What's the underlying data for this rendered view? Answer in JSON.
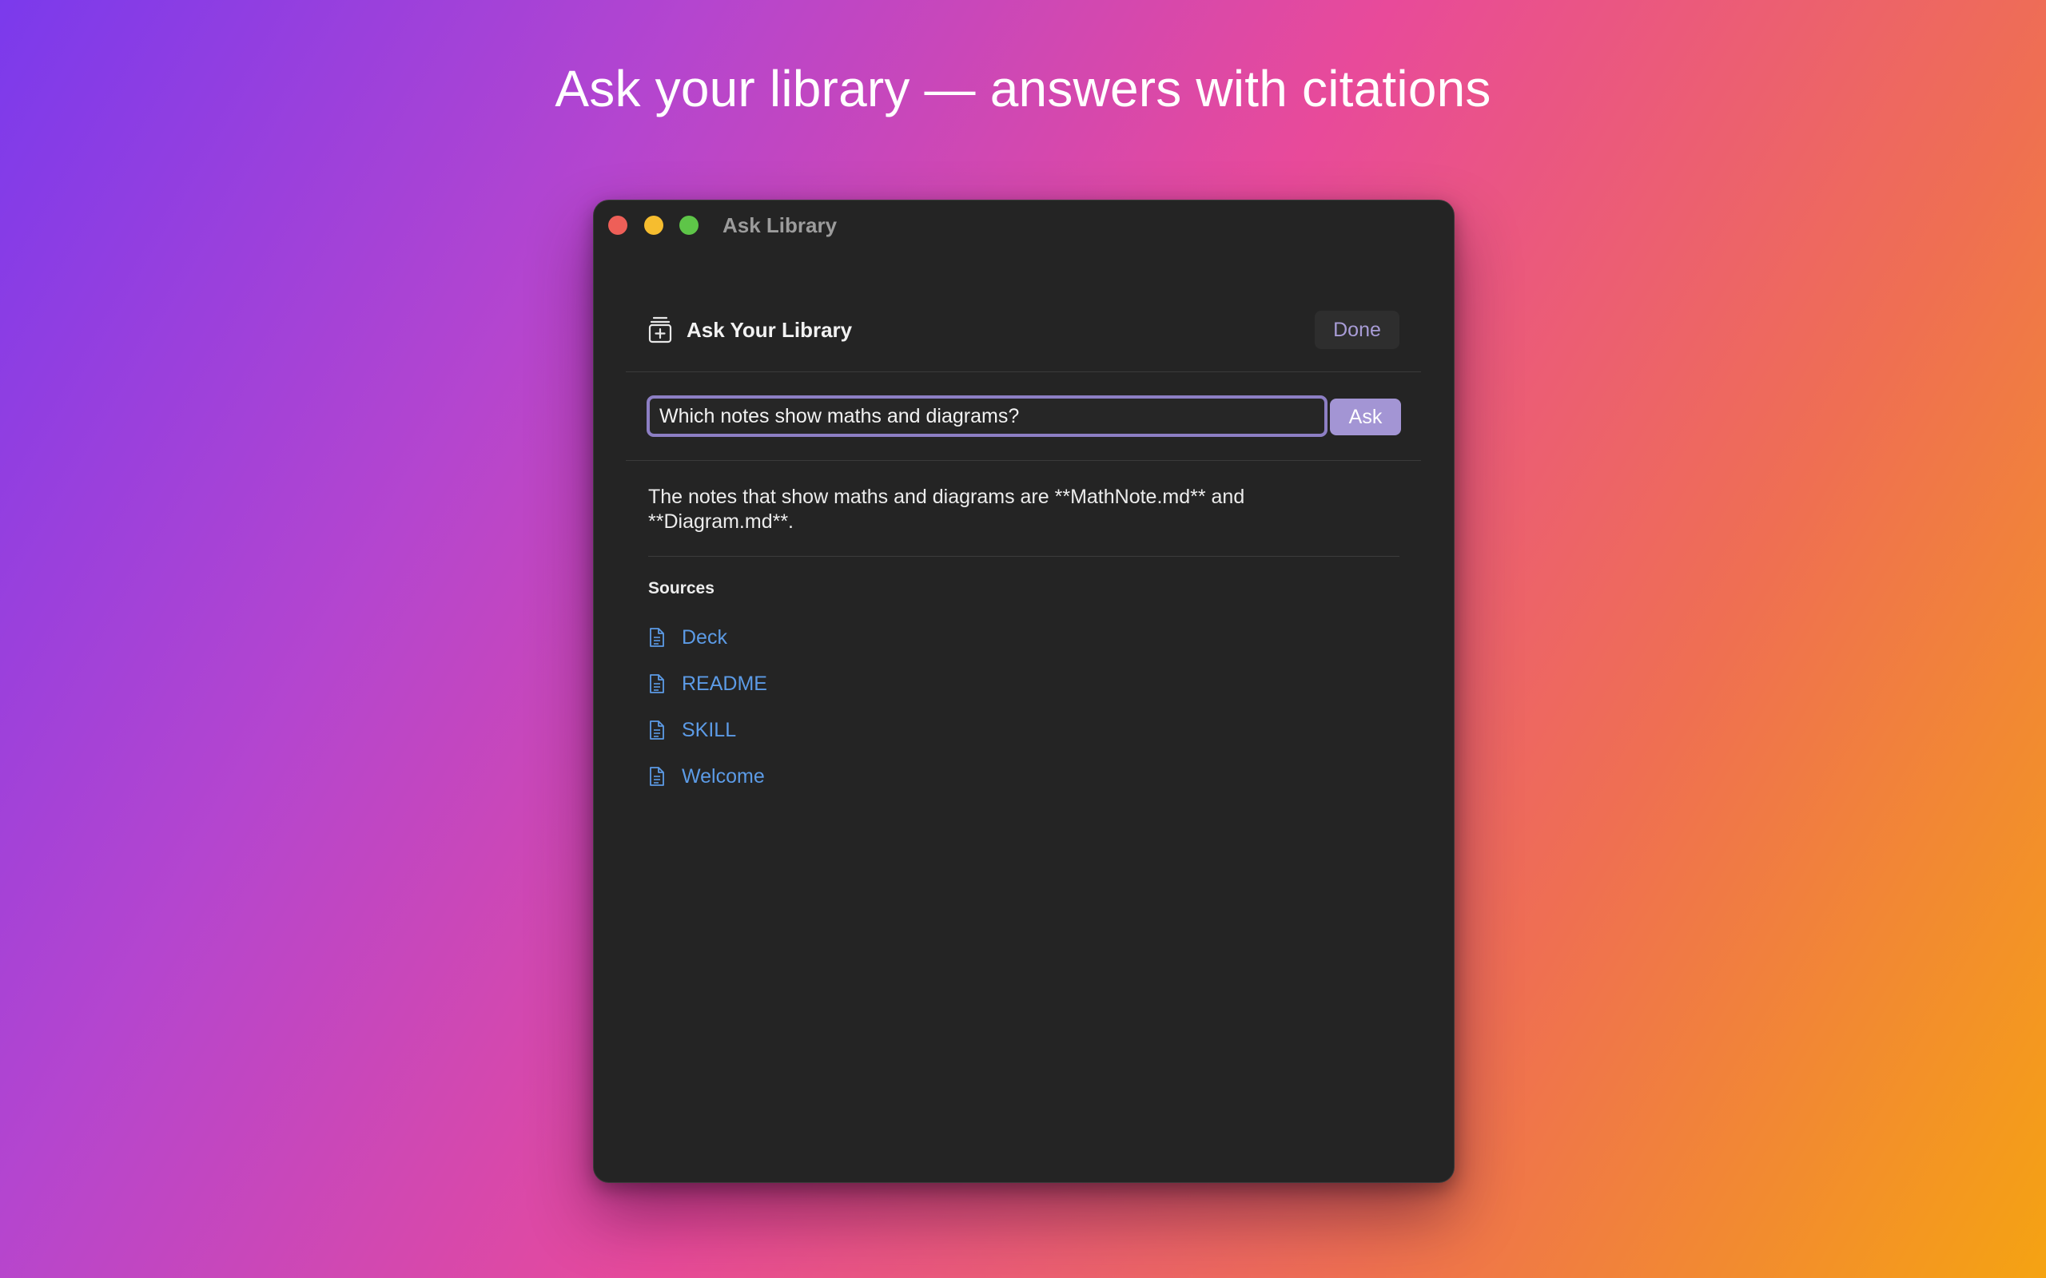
{
  "headline": "Ask your library — answers with citations",
  "window": {
    "title": "Ask Library"
  },
  "panel": {
    "title": "Ask Your Library",
    "done_label": "Done",
    "icon": "archive-box-plus-icon"
  },
  "query": {
    "value": "Which notes show maths and diagrams?",
    "ask_label": "Ask"
  },
  "answer": {
    "text": "The notes that show maths and diagrams are **MathNote.md** and **Diagram.md**."
  },
  "sources": {
    "heading": "Sources",
    "items": [
      {
        "label": "Deck",
        "icon": "document-icon"
      },
      {
        "label": "README",
        "icon": "document-icon"
      },
      {
        "label": "SKILL",
        "icon": "document-icon"
      },
      {
        "label": "Welcome",
        "icon": "document-icon"
      }
    ]
  },
  "colors": {
    "accent": "#a395d4",
    "link": "#5c9be6",
    "window_bg": "#242424",
    "close": "#ee5f58",
    "minimize": "#f6bd2f",
    "maximize": "#5ec548"
  }
}
